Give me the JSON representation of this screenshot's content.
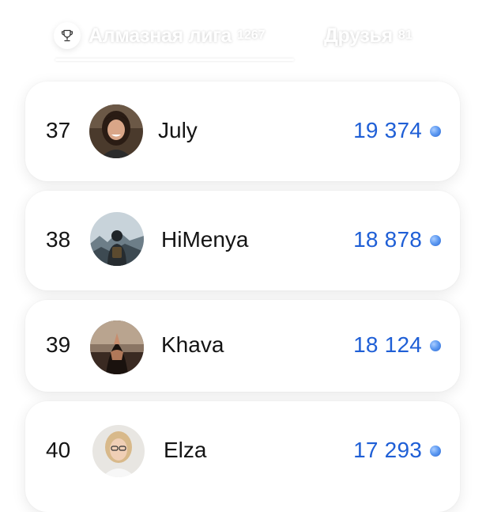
{
  "tabs": {
    "league": {
      "label": "Алмазная лига",
      "count": "1267",
      "icon": "trophy-icon"
    },
    "friends": {
      "label": "Друзья",
      "count": "81"
    }
  },
  "leaderboard": [
    {
      "rank": "37",
      "name": "July",
      "score": "19 374"
    },
    {
      "rank": "38",
      "name": "HiMenya",
      "score": "18 878"
    },
    {
      "rank": "39",
      "name": "Khava",
      "score": "18 124"
    },
    {
      "rank": "40",
      "name": "Elza",
      "score": "17 293"
    }
  ],
  "colors": {
    "score": "#1f5fd6",
    "gem": "#4f8ff0",
    "text": "#141414",
    "card": "#ffffff"
  }
}
